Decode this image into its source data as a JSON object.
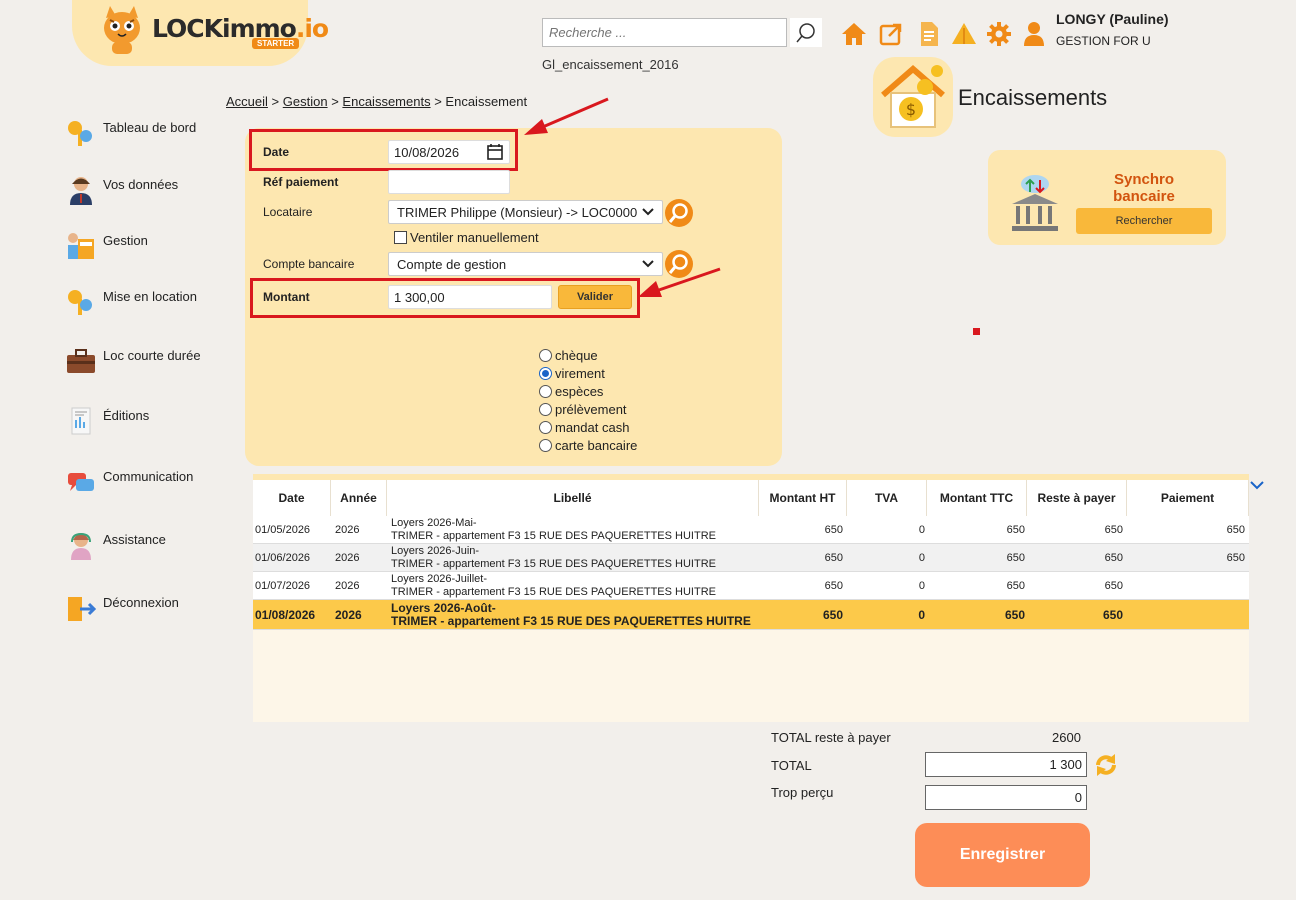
{
  "app": {
    "brand_main": "LOCKimmo",
    "brand_suffix": ".io",
    "plan_badge": "STARTER"
  },
  "header": {
    "search_placeholder": "Recherche ...",
    "file_name": "Gl_encaissement_2016",
    "icons": [
      "home-icon",
      "external-link-icon",
      "document-icon",
      "alert-icon",
      "gear-icon",
      "user-icon"
    ],
    "user_name": "LONGY (Pauline)",
    "company": "GESTION FOR U"
  },
  "page_title": "Encaissements",
  "breadcrumb": {
    "items": [
      "Accueil",
      "Gestion",
      "Encaissements"
    ],
    "current": "Encaissement",
    "sep": ">"
  },
  "sidebar": {
    "items": [
      {
        "label": "Tableau de bord",
        "icon": "keys-icon"
      },
      {
        "label": "Vos données",
        "icon": "person-icon"
      },
      {
        "label": "Gestion",
        "icon": "calculator-icon"
      },
      {
        "label": "Mise en location",
        "icon": "keys-icon"
      },
      {
        "label": "Loc courte durée",
        "icon": "suitcase-icon"
      },
      {
        "label": "Éditions",
        "icon": "report-icon"
      },
      {
        "label": "Communication",
        "icon": "chat-icon"
      },
      {
        "label": "Assistance",
        "icon": "support-icon"
      },
      {
        "label": "Déconnexion",
        "icon": "logout-icon"
      }
    ]
  },
  "form": {
    "date_label": "Date",
    "date_value": "10/08/2026",
    "ref_label": "Réf paiement",
    "ref_value": "",
    "locataire_label": "Locataire",
    "locataire_value": "TRIMER Philippe (Monsieur) -> LOC0000",
    "ventiler_label": "Ventiler manuellement",
    "compte_label": "Compte bancaire",
    "compte_value": "Compte de gestion",
    "montant_label": "Montant",
    "montant_value": "1 300,00",
    "valider_label": "Valider",
    "payment_modes": [
      {
        "label": "chèque",
        "checked": false
      },
      {
        "label": "virement",
        "checked": true
      },
      {
        "label": "espèces",
        "checked": false
      },
      {
        "label": "prélèvement",
        "checked": false
      },
      {
        "label": "mandat cash",
        "checked": false
      },
      {
        "label": "carte bancaire",
        "checked": false
      }
    ]
  },
  "synchro": {
    "title": "Synchro bancaire",
    "button": "Rechercher"
  },
  "table": {
    "headers": [
      "Date",
      "Année",
      "Libellé",
      "Montant HT",
      "TVA",
      "Montant TTC",
      "Reste à payer",
      "Paiement"
    ],
    "rows": [
      {
        "date": "01/05/2026",
        "annee": "2026",
        "lib1": "Loyers 2026-Mai-",
        "lib2": "TRIMER - appartement F3 15 RUE DES PAQUERETTES HUITRE",
        "ht": "650",
        "tva": "0",
        "ttc": "650",
        "reste": "650",
        "paiement": "650"
      },
      {
        "date": "01/06/2026",
        "annee": "2026",
        "lib1": "Loyers 2026-Juin-",
        "lib2": "TRIMER - appartement F3 15 RUE DES PAQUERETTES HUITRE",
        "ht": "650",
        "tva": "0",
        "ttc": "650",
        "reste": "650",
        "paiement": "650"
      },
      {
        "date": "01/07/2026",
        "annee": "2026",
        "lib1": "Loyers 2026-Juillet-",
        "lib2": "TRIMER - appartement F3 15 RUE DES PAQUERETTES HUITRE",
        "ht": "650",
        "tva": "0",
        "ttc": "650",
        "reste": "650",
        "paiement": ""
      },
      {
        "date": "01/08/2026",
        "annee": "2026",
        "lib1": "Loyers 2026-Août-",
        "lib2": "TRIMER - appartement F3 15 RUE DES PAQUERETTES HUITRE",
        "ht": "650",
        "tva": "0",
        "ttc": "650",
        "reste": "650",
        "paiement": ""
      }
    ]
  },
  "totals": {
    "reste_label": "TOTAL reste à payer",
    "reste_value": "2600",
    "total_label": "TOTAL",
    "total_value": "1 300",
    "trop_label": "Trop perçu",
    "trop_value": "0"
  },
  "save_label": "Enregistrer",
  "colors": {
    "accent": "#f08a17",
    "panel": "#fde7b0",
    "highlight_row": "#fcc94a",
    "save": "#fd8d57",
    "annotation_red": "#d9181e"
  }
}
